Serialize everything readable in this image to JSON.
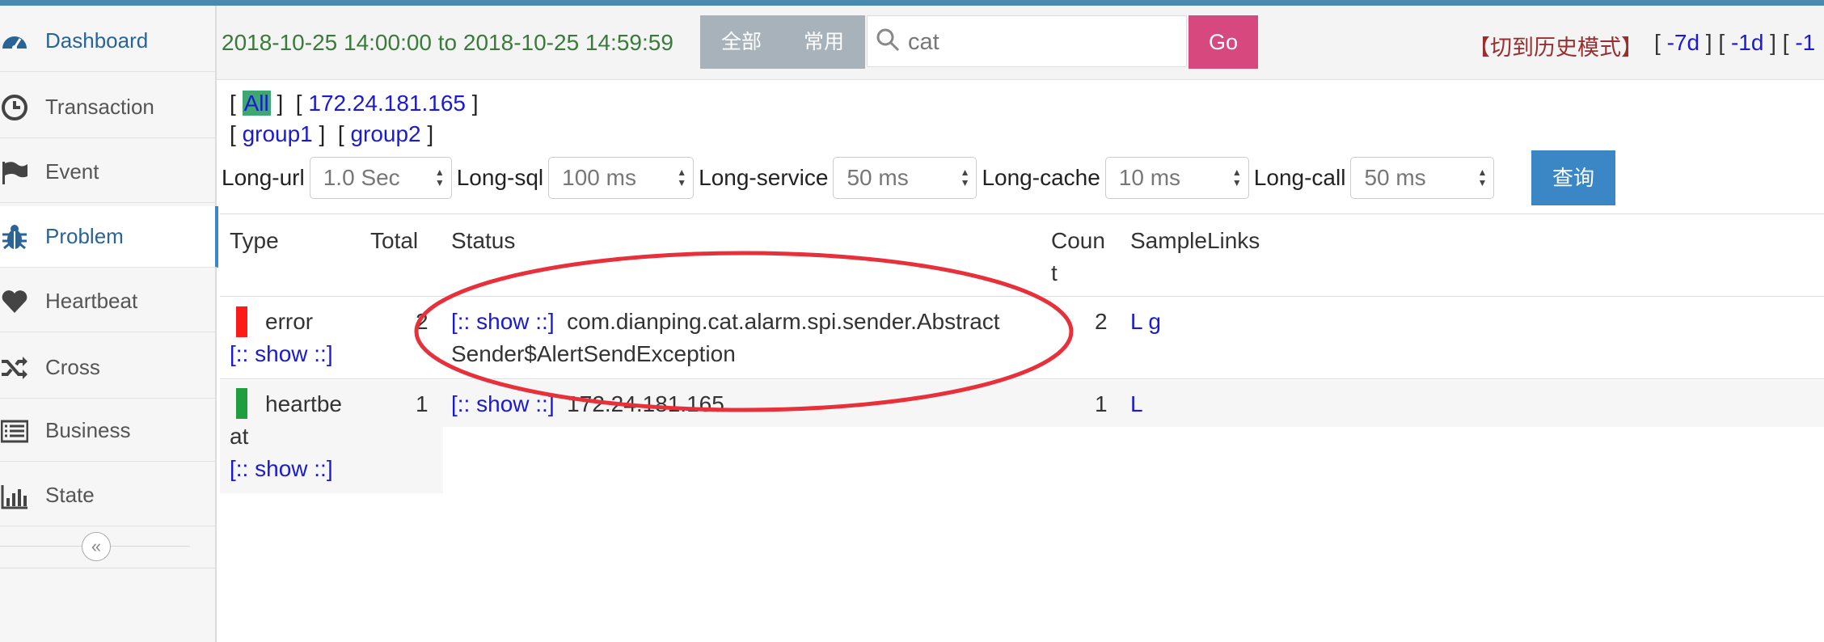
{
  "sidebar": {
    "items": [
      {
        "label": "Dashboard",
        "icon": "dashboard-icon"
      },
      {
        "label": "Transaction",
        "icon": "clock-icon"
      },
      {
        "label": "Event",
        "icon": "flag-icon"
      },
      {
        "label": "Problem",
        "icon": "bug-icon"
      },
      {
        "label": "Heartbeat",
        "icon": "heart-icon"
      },
      {
        "label": "Cross",
        "icon": "shuffle-icon"
      },
      {
        "label": "Business",
        "icon": "list-icon"
      },
      {
        "label": "State",
        "icon": "bar-chart-icon"
      }
    ],
    "active": "Problem",
    "collapse_glyph": "«"
  },
  "header": {
    "time_range": "2018-10-25 14:00:00 to 2018-10-25 14:59:59",
    "seg_all": "全部",
    "seg_common": "常用",
    "search_value": "cat",
    "go_label": "Go",
    "history_mode": "【切到历史模式】",
    "day_links": [
      "-7d",
      "-1d",
      "-1"
    ]
  },
  "filters": {
    "row1": [
      "All",
      "172.24.181.165"
    ],
    "row2": [
      "group1",
      "group2"
    ],
    "thresholds": [
      {
        "label": "Long-url",
        "value": "1.0 Sec"
      },
      {
        "label": "Long-sql",
        "value": "100 ms"
      },
      {
        "label": "Long-service",
        "value": "50 ms"
      },
      {
        "label": "Long-cache",
        "value": "10 ms"
      },
      {
        "label": "Long-call",
        "value": "50 ms"
      }
    ],
    "query_label": "查询"
  },
  "table": {
    "headers": {
      "type": "Type",
      "total": "Total",
      "status": "Status",
      "count_1": "Coun",
      "count_2": "t",
      "samples": "SampleLinks"
    },
    "rows": [
      {
        "type_1": "error",
        "type_2": "",
        "type_show": "[:: show ::]",
        "total": "2",
        "status_show": "[:: show ::]",
        "status_1": "com.dianping.cat.alarm.spi.sender.Abstract",
        "status_2": "Sender$AlertSendException",
        "count": "2",
        "samples": [
          "L",
          "g"
        ],
        "bar_color": "#ff1a1a"
      },
      {
        "type_1": "heartbe",
        "type_2": "at",
        "type_show": "[:: show ::]",
        "total": "1",
        "status_show": "[:: show ::]",
        "status_1": "172.24.181.165",
        "status_2": "",
        "count": "1",
        "samples": [
          "L"
        ],
        "bar_color": "#1e9e3e"
      }
    ]
  },
  "annotation_color": "#e8303a"
}
